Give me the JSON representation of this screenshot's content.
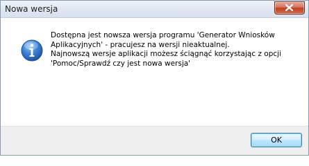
{
  "window": {
    "title": "Nowa wersja",
    "close_icon": "close-icon"
  },
  "message": {
    "icon": "info-icon",
    "lines": [
      "Dostępna jest nowsza wersja programu 'Generator Wniosków",
      "Aplikacyjnych' - pracujesz na wersji nieaktualnej.",
      "Najnowszą wersje aplikacji możesz ściągnąć korzystając z opcji",
      "'Pomoc/Sprawdź czy jest nowa wersja'"
    ]
  },
  "buttons": {
    "ok_label": "OK"
  },
  "colors": {
    "titlebar": "#dfe7f1",
    "close_button": "#c13f20",
    "info_icon": "#2f73c9",
    "footer": "#f0f0f0",
    "ok_button_border": "#3c7fb1"
  }
}
